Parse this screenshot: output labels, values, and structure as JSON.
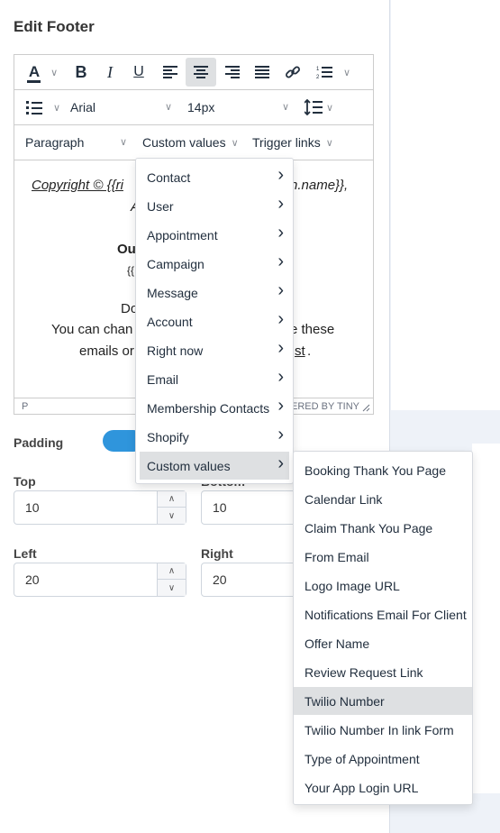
{
  "panel": {
    "title": "Edit Footer"
  },
  "toolbar": {
    "font_family": "Arial",
    "font_size": "14px",
    "block_format": "Paragraph",
    "custom_values": "Custom values",
    "trigger_links": "Trigger links"
  },
  "content": {
    "line1_a": "Copyright © {{ri",
    "line1_b": "n.name}},",
    "line2": "A",
    "line3": "Ou",
    "line4": "{{",
    "line5": "Do",
    "line6_a": "You can chan",
    "line6_b": "e these",
    "line7_a": "emails or",
    "line7_b": "st",
    "line7_c": "."
  },
  "statusbar": {
    "path": "P",
    "brand": "ERED BY TINY"
  },
  "padding": {
    "label": "Padding",
    "enabled": true,
    "top_label": "Top",
    "top_value": "10",
    "bottom_label": "Bottom",
    "bottom_value": "10",
    "left_label": "Left",
    "left_value": "20",
    "right_label": "Right",
    "right_value": "20"
  },
  "menu": {
    "items": [
      "Contact",
      "User",
      "Appointment",
      "Campaign",
      "Message",
      "Account",
      "Right now",
      "Email",
      "Membership Contacts",
      "Shopify",
      "Custom values"
    ],
    "highlighted": "Custom values"
  },
  "submenu": {
    "items": [
      "Booking Thank You Page",
      "Calendar Link",
      "Claim Thank You Page",
      "From Email",
      "Logo Image URL",
      "Notifications Email For Client",
      "Offer Name",
      "Review Request Link",
      "Twilio Number",
      "Twilio Number In link Form",
      "Type of Appointment",
      "Your App Login URL"
    ],
    "highlighted": "Twilio Number"
  },
  "colors": {
    "accent": "#2f95dc",
    "highlight": "#dee0e2"
  },
  "icons": [
    "font-color-icon",
    "bold-icon",
    "italic-icon",
    "underline-icon",
    "align-left-icon",
    "align-center-icon",
    "align-right-icon",
    "align-justify-icon",
    "link-icon",
    "numbered-list-icon",
    "bullet-list-icon",
    "line-height-icon",
    "chevron-right-icon"
  ]
}
